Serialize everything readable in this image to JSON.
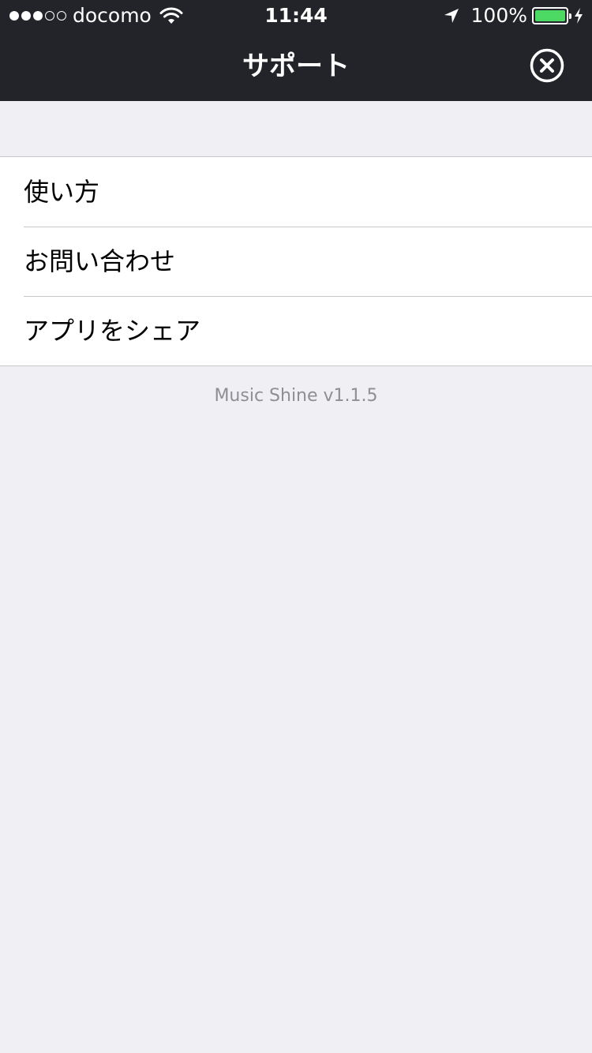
{
  "status_bar": {
    "signal_filled": 3,
    "signal_total": 5,
    "carrier": "docomo",
    "time": "11:44",
    "battery_percent": "100%",
    "battery_level": 1.0,
    "icons": [
      "wifi-icon",
      "location-arrow-icon",
      "battery-icon",
      "charging-bolt-icon"
    ]
  },
  "nav": {
    "title": "サポート",
    "close_icon": "close-circle-icon"
  },
  "menu": {
    "items": [
      {
        "label": "使い方"
      },
      {
        "label": "お問い合わせ"
      },
      {
        "label": "アプリをシェア"
      }
    ]
  },
  "footer": {
    "version": "Music Shine v1.1.5"
  },
  "colors": {
    "bar_background": "#23242a",
    "page_background": "#efeff4",
    "battery_fill": "#4cd964",
    "separator": "#c8c7cc",
    "secondary_text": "#8e8e93"
  }
}
